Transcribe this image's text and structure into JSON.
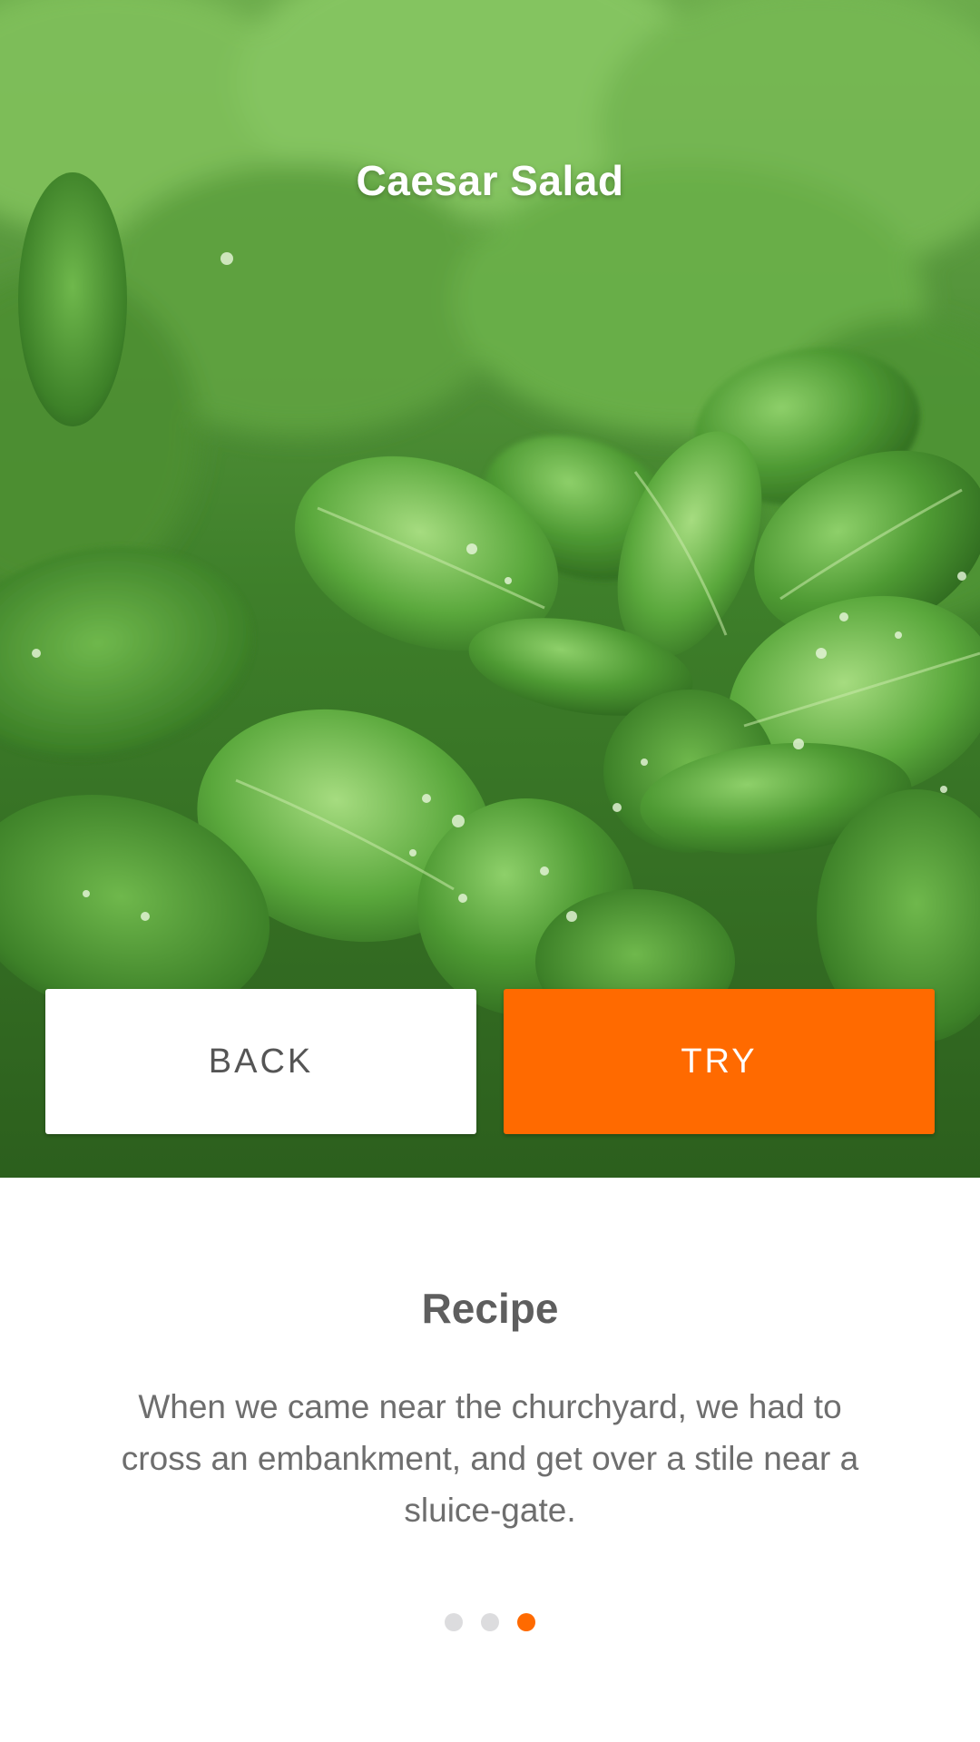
{
  "hero": {
    "title": "Caesar Salad"
  },
  "actions": {
    "back_label": "BACK",
    "try_label": "TRY"
  },
  "recipe": {
    "heading": "Recipe",
    "body": "When we came near the churchyard, we had to cross an embankment, and get over a stile near a sluice-gate."
  },
  "pager": {
    "page_count": 3,
    "active_index": 3
  },
  "colors": {
    "accent": "#ff6a00",
    "heading_text": "#5e5e5e",
    "body_text": "#6e6e6e",
    "inactive_dot": "#dcdcde"
  }
}
